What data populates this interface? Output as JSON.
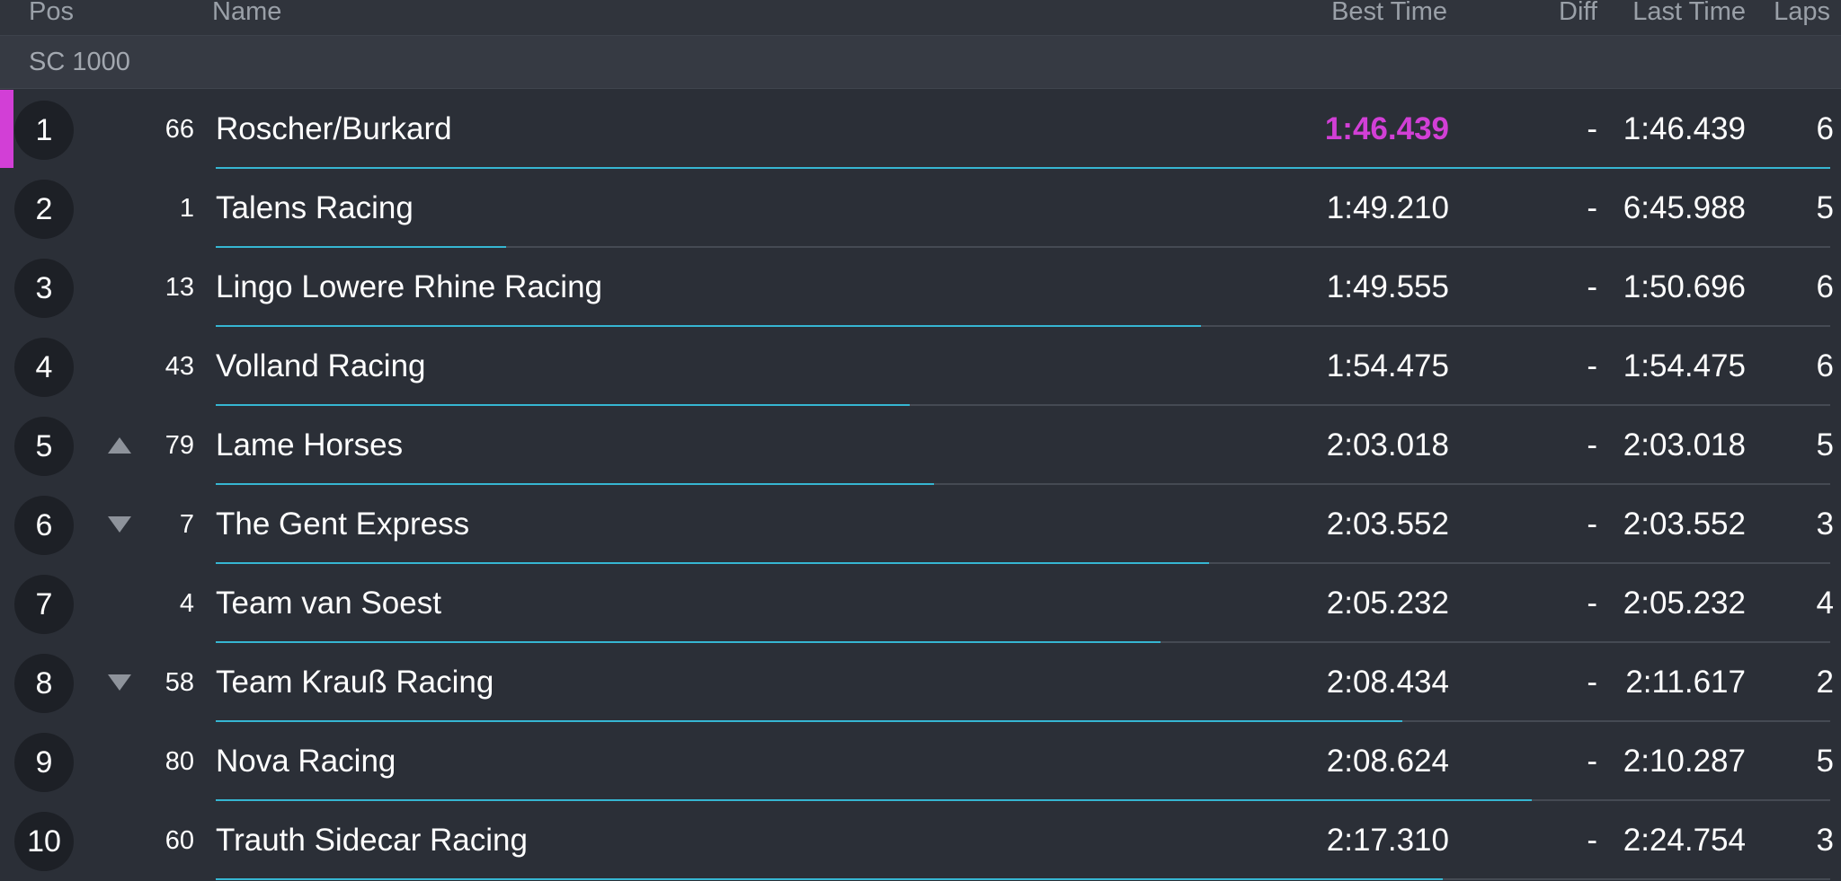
{
  "header": {
    "pos": "Pos",
    "name": "Name",
    "best_time": "Best Time",
    "diff": "Diff",
    "last_time": "Last Time",
    "laps": "Laps"
  },
  "group": {
    "label": "SC 1000"
  },
  "colors": {
    "fastest": "#d23fd6",
    "progress": "#36b6d2",
    "trend_icon": "#8e939b"
  },
  "rows": [
    {
      "pos": "1",
      "trend": "none",
      "number": "66",
      "name": "Roscher/Burkard",
      "best_time": "1:46.439",
      "fastest": true,
      "diff": "-",
      "last_time": "1:46.439",
      "laps": "6",
      "progress": 1.0
    },
    {
      "pos": "2",
      "trend": "none",
      "number": "1",
      "name": "Talens Racing",
      "best_time": "1:49.210",
      "fastest": false,
      "diff": "-",
      "last_time": "6:45.988",
      "laps": "5",
      "progress": 0.18
    },
    {
      "pos": "3",
      "trend": "none",
      "number": "13",
      "name": "Lingo Lowere Rhine Racing",
      "best_time": "1:49.555",
      "fastest": false,
      "diff": "-",
      "last_time": "1:50.696",
      "laps": "6",
      "progress": 0.61
    },
    {
      "pos": "4",
      "trend": "none",
      "number": "43",
      "name": "Volland Racing",
      "best_time": "1:54.475",
      "fastest": false,
      "diff": "-",
      "last_time": "1:54.475",
      "laps": "6",
      "progress": 0.43
    },
    {
      "pos": "5",
      "trend": "up",
      "number": "79",
      "name": "Lame Horses",
      "best_time": "2:03.018",
      "fastest": false,
      "diff": "-",
      "last_time": "2:03.018",
      "laps": "5",
      "progress": 0.445
    },
    {
      "pos": "6",
      "trend": "down",
      "number": "7",
      "name": "The Gent Express",
      "best_time": "2:03.552",
      "fastest": false,
      "diff": "-",
      "last_time": "2:03.552",
      "laps": "3",
      "progress": 0.615
    },
    {
      "pos": "7",
      "trend": "none",
      "number": "4",
      "name": "Team van Soest",
      "best_time": "2:05.232",
      "fastest": false,
      "diff": "-",
      "last_time": "2:05.232",
      "laps": "4",
      "progress": 0.585
    },
    {
      "pos": "8",
      "trend": "down",
      "number": "58",
      "name": "Team Krauß Racing",
      "best_time": "2:08.434",
      "fastest": false,
      "diff": "-",
      "last_time": "2:11.617",
      "laps": "2",
      "progress": 0.735
    },
    {
      "pos": "9",
      "trend": "none",
      "number": "80",
      "name": "Nova Racing",
      "best_time": "2:08.624",
      "fastest": false,
      "diff": "-",
      "last_time": "2:10.287",
      "laps": "5",
      "progress": 0.815
    },
    {
      "pos": "10",
      "trend": "none",
      "number": "60",
      "name": "Trauth Sidecar Racing",
      "best_time": "2:17.310",
      "fastest": false,
      "diff": "-",
      "last_time": "2:24.754",
      "laps": "3",
      "progress": 0.76
    }
  ]
}
